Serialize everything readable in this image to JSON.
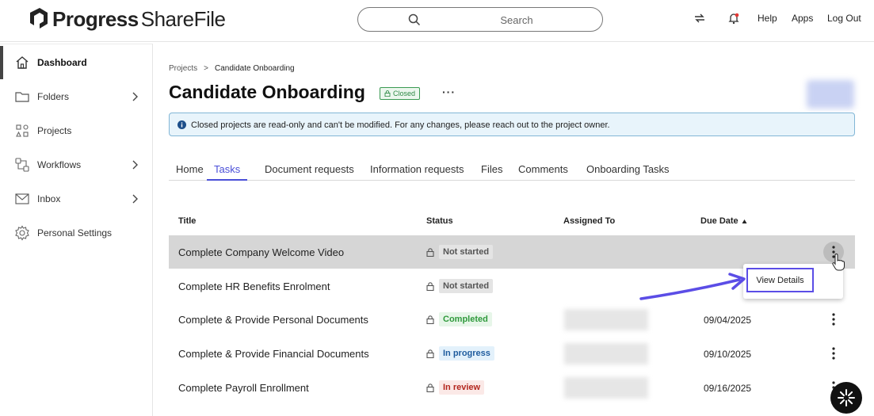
{
  "brand": {
    "name_bold": "Progress",
    "name_light": "ShareFile"
  },
  "header": {
    "search_placeholder": "Search",
    "links": {
      "help": "Help",
      "apps": "Apps",
      "logout": "Log Out"
    }
  },
  "sidebar": {
    "items": [
      {
        "label": "Dashboard",
        "icon": "home-icon",
        "active": true,
        "has_chevron": false
      },
      {
        "label": "Folders",
        "icon": "folder-icon",
        "active": false,
        "has_chevron": true
      },
      {
        "label": "Projects",
        "icon": "projects-icon",
        "active": false,
        "has_chevron": false
      },
      {
        "label": "Workflows",
        "icon": "workflows-icon",
        "active": false,
        "has_chevron": true
      },
      {
        "label": "Inbox",
        "icon": "mail-icon",
        "active": false,
        "has_chevron": true
      },
      {
        "label": "Personal Settings",
        "icon": "gear-icon",
        "active": false,
        "has_chevron": false
      }
    ]
  },
  "breadcrumb": {
    "root": "Projects",
    "separator": ">",
    "current": "Candidate Onboarding"
  },
  "page": {
    "title": "Candidate Onboarding",
    "badge": "Closed",
    "more": "···"
  },
  "banner": {
    "text": "Closed projects are read-only and can't be modified. For any changes, please reach out to the project owner."
  },
  "tabs": [
    {
      "label": "Home",
      "active": false
    },
    {
      "label": "Tasks",
      "active": true
    },
    {
      "label": "Document requests",
      "active": false
    },
    {
      "label": "Information requests",
      "active": false
    },
    {
      "label": "Files",
      "active": false
    },
    {
      "label": "Comments",
      "active": false
    },
    {
      "label": "Onboarding Tasks",
      "active": false
    }
  ],
  "table": {
    "headers": {
      "title": "Title",
      "status": "Status",
      "assigned": "Assigned To",
      "due": "Due Date"
    },
    "sort": "due-date-ascending",
    "rows": [
      {
        "title": "Complete Company Welcome Video",
        "status": "Not started",
        "due": "",
        "assigned_visible": false
      },
      {
        "title": "Complete HR Benefits Enrolment",
        "status": "Not started",
        "due": "",
        "assigned_visible": false
      },
      {
        "title": "Complete & Provide Personal Documents",
        "status": "Completed",
        "due": "09/04/2025",
        "assigned_visible": true
      },
      {
        "title": "Complete & Provide Financial Documents",
        "status": "In progress",
        "due": "09/10/2025",
        "assigned_visible": true
      },
      {
        "title": "Complete Payroll Enrollment",
        "status": "In review",
        "due": "09/16/2025",
        "assigned_visible": true
      }
    ]
  },
  "context_menu": {
    "item": "View Details"
  },
  "colors": {
    "accent": "#4a4fd8",
    "annotation": "#5b4de6",
    "status_not_started_bg": "#e4e4e4",
    "status_not_started_fg": "#555555",
    "status_completed_bg": "#e7f6e9",
    "status_completed_fg": "#2f9a3c",
    "status_in_progress_bg": "#e3f1fb",
    "status_in_progress_fg": "#1f5c9e",
    "status_in_review_bg": "#fbe9e7",
    "status_in_review_fg": "#b3261e"
  }
}
